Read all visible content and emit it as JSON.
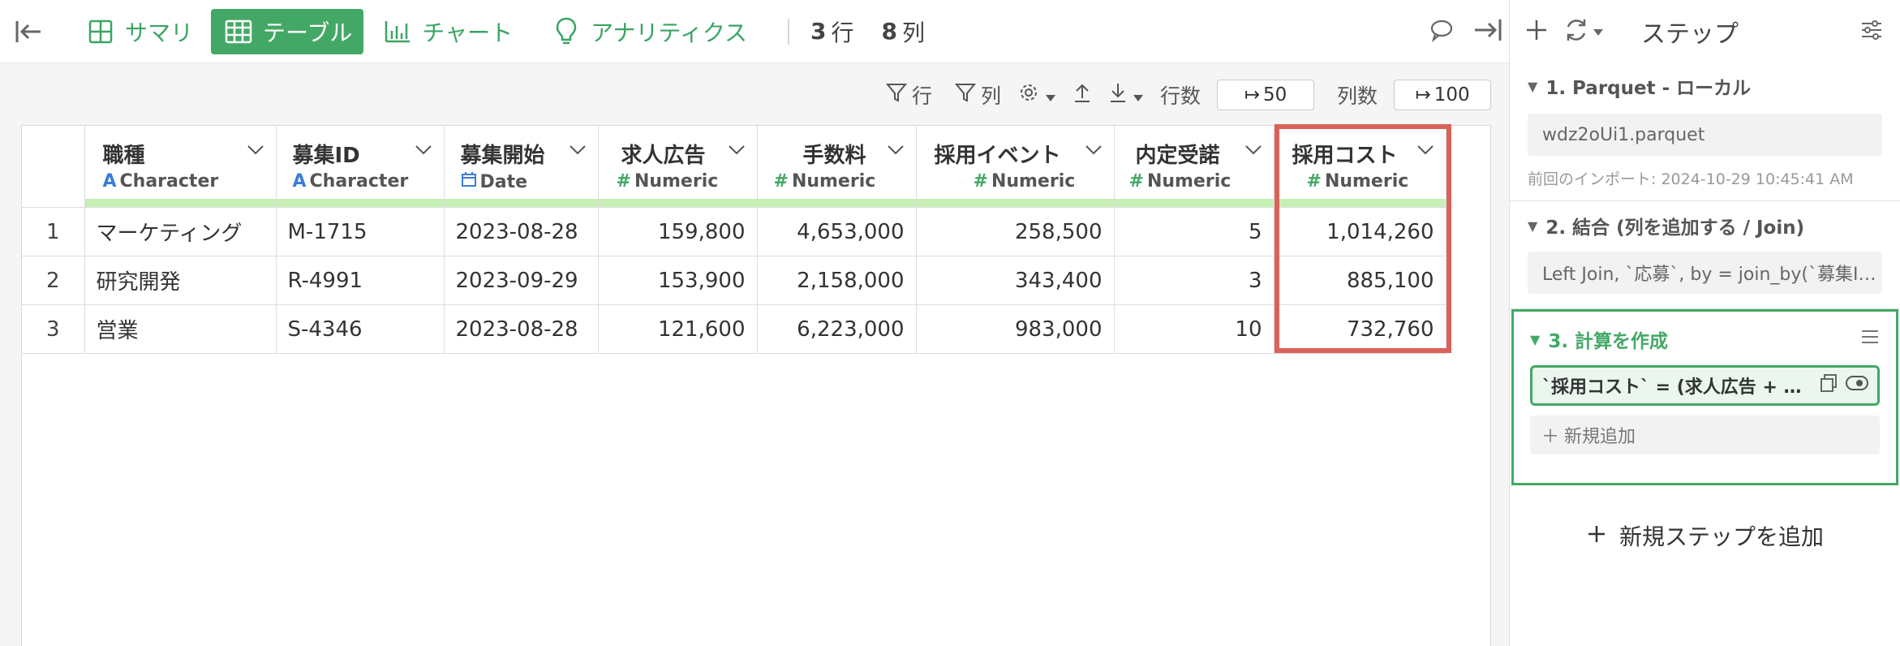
{
  "topbar": {
    "tabs": [
      {
        "label": "サマリ",
        "icon": "summary-grid-icon"
      },
      {
        "label": "テーブル",
        "icon": "table-icon",
        "active": true
      },
      {
        "label": "チャート",
        "icon": "bar-chart-icon"
      },
      {
        "label": "アナリティクス",
        "icon": "lightbulb-icon"
      }
    ],
    "rows_count": "3",
    "rows_unit": "行",
    "cols_count": "8",
    "cols_unit": "列"
  },
  "toolbar": {
    "row_filter_label": "行",
    "col_filter_label": "列",
    "row_count_label": "行数",
    "row_count_value": "50",
    "col_count_label": "列数",
    "col_count_value": "100"
  },
  "table": {
    "columns": [
      {
        "name": "職種",
        "type": "Character"
      },
      {
        "name": "募集ID",
        "type": "Character"
      },
      {
        "name": "募集開始",
        "type": "Date"
      },
      {
        "name": "求人広告",
        "type": "Numeric"
      },
      {
        "name": "手数料",
        "type": "Numeric"
      },
      {
        "name": "採用イベント",
        "type": "Numeric"
      },
      {
        "name": "内定受諾",
        "type": "Numeric"
      },
      {
        "name": "採用コスト",
        "type": "Numeric"
      }
    ],
    "rows": [
      [
        "1",
        "マーケティング",
        "M-1715",
        "2023-08-28",
        "159,800",
        "4,653,000",
        "258,500",
        "5",
        "1,014,260"
      ],
      [
        "2",
        "研究開発",
        "R-4991",
        "2023-09-29",
        "153,900",
        "2,158,000",
        "343,400",
        "3",
        "885,100"
      ],
      [
        "3",
        "営業",
        "S-4346",
        "2023-08-28",
        "121,600",
        "6,223,000",
        "983,000",
        "10",
        "732,760"
      ]
    ],
    "highlight_color": "#d9625a"
  },
  "panel": {
    "title": "ステップ",
    "steps": [
      {
        "title": "1. Parquet - ローカル",
        "detail": "wdz2oUi1.parquet",
        "meta": "前回のインポート: 2024-10-29 10:45:41 AM"
      },
      {
        "title": "2. 結合 (列を追加する / Join)",
        "detail": "Left Join, `応募`, by = join_by(`募集I…"
      },
      {
        "title": "3. 計算を作成",
        "formula": "`採用コスト` = (求人広告 + …",
        "add_label": "新規追加"
      }
    ],
    "add_step_label": "新規ステップを追加"
  },
  "colors": {
    "accent": "#43a866",
    "highlight": "#d9625a",
    "header_bar": "#c6f0b6"
  }
}
